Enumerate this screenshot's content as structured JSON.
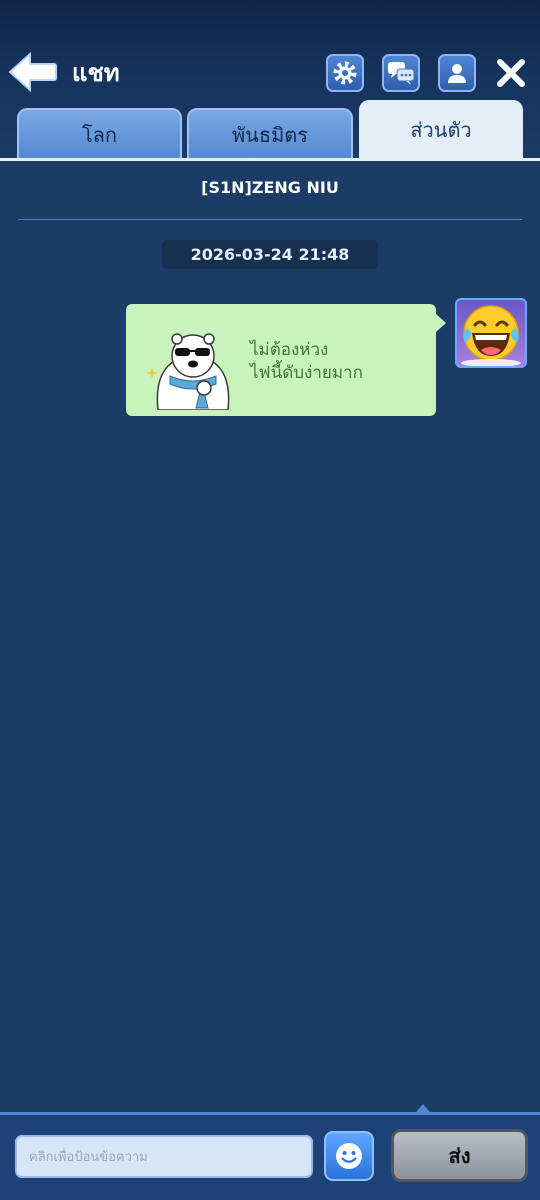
{
  "header": {
    "title": "แชท",
    "icons": [
      "back-arrow-icon",
      "settings-gear-icon",
      "chat-bubbles-icon",
      "profile-icon",
      "close-icon"
    ]
  },
  "tabs": [
    {
      "label": "โลก",
      "active": false
    },
    {
      "label": "พันธมิตร",
      "active": false
    },
    {
      "label": "ส่วนตัว",
      "active": true
    }
  ],
  "conversation": {
    "contact_name": "[S1N]ZENG NIU",
    "timestamp": "2026-03-24 21:48",
    "messages": [
      {
        "sender": "self",
        "sticker": "polar-bear-sunglasses-thumbs-up",
        "text_line1": "ไม่ต้องห่วง",
        "text_line2": "ไฟนี้ดับง่ายมาก",
        "avatar": "laughing-tears-emoji"
      }
    ]
  },
  "composer": {
    "placeholder": "คลิกเพื่อป้อนข้อความ",
    "send_label": "ส่ง",
    "emoji_icon": "smiley-icon"
  },
  "colors": {
    "background": "#1b3c66",
    "bubble": "#c8f3bd",
    "bubble_text": "#3f7a36",
    "active_tab": "#e3eef7",
    "inactive_tab": "#6a9ad9"
  }
}
